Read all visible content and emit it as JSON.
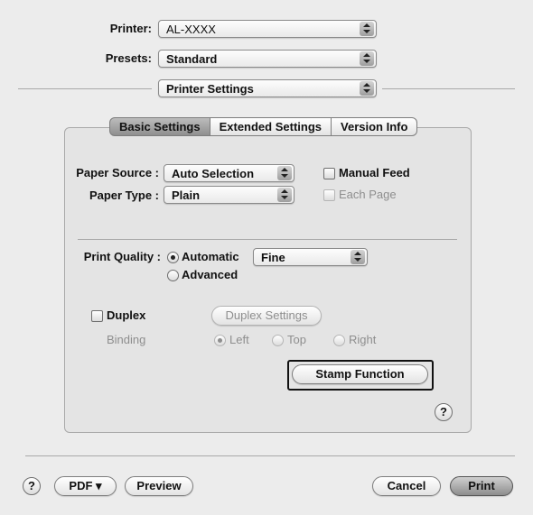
{
  "header": {
    "printer": {
      "label": "Printer:",
      "value": "AL-XXXX"
    },
    "presets": {
      "label": "Presets:",
      "value": "Standard"
    },
    "panel_select": {
      "value": "Printer Settings"
    }
  },
  "tabs": [
    {
      "label": "Basic Settings",
      "selected": true
    },
    {
      "label": "Extended Settings",
      "selected": false
    },
    {
      "label": "Version Info",
      "selected": false
    }
  ],
  "paper": {
    "source_label": "Paper Source :",
    "source_value": "Auto Selection",
    "type_label": "Paper Type :",
    "type_value": "Plain",
    "manual_feed": "Manual Feed",
    "each_page": "Each Page"
  },
  "quality": {
    "label": "Print Quality :",
    "automatic": "Automatic",
    "advanced": "Advanced",
    "level_value": "Fine"
  },
  "duplex": {
    "label": "Duplex",
    "settings_button": "Duplex Settings",
    "binding_label": "Binding",
    "left": "Left",
    "top": "Top",
    "right": "Right"
  },
  "stamp_button": "Stamp Function",
  "footer": {
    "pdf": "PDF ▾",
    "preview": "Preview",
    "cancel": "Cancel",
    "print": "Print"
  },
  "help_glyph": "?"
}
